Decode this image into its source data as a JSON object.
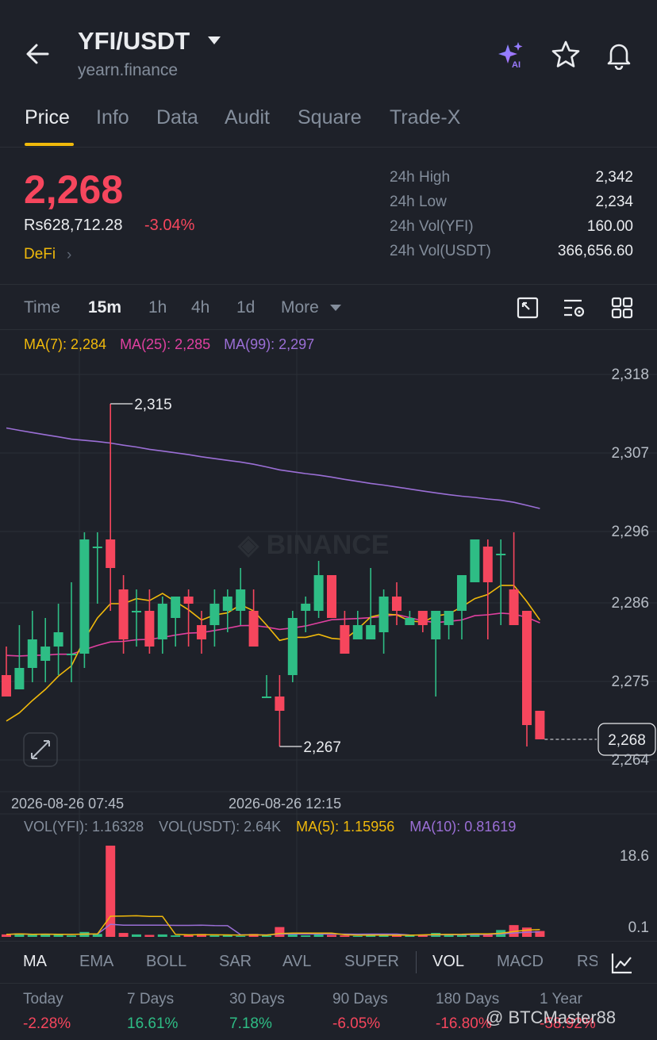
{
  "header": {
    "pair": "YFI/USDT",
    "subtitle": "yearn.finance"
  },
  "tabs": [
    "Price",
    "Info",
    "Data",
    "Audit",
    "Square",
    "Trade-X"
  ],
  "price": {
    "last": "2,268",
    "fiat": "Rs628,712.28",
    "change": "-3.04%",
    "sector": "DeFi"
  },
  "stats": [
    {
      "label": "24h High",
      "value": "2,342"
    },
    {
      "label": "24h Low",
      "value": "2,234"
    },
    {
      "label": "24h Vol(YFI)",
      "value": "160.00"
    },
    {
      "label": "24h Vol(USDT)",
      "value": "366,656.60"
    }
  ],
  "intervals": [
    "Time",
    "15m",
    "1h",
    "4h",
    "1d",
    "More"
  ],
  "ma_legend": {
    "ma7": "MA(7): 2,284",
    "ma25": "MA(25): 2,285",
    "ma99": "MA(99): 2,297"
  },
  "vol_legend": {
    "vol_yfi": "VOL(YFI): 1.16328",
    "vol_usdt": "VOL(USDT): 2.64K",
    "ma5": "MA(5): 1.15956",
    "ma10": "MA(10): 0.81619"
  },
  "indicators": [
    "MA",
    "EMA",
    "BOLL",
    "SAR",
    "AVL",
    "SUPER",
    "VOL",
    "MACD",
    "RS"
  ],
  "performance": [
    {
      "label": "Today",
      "value": "-2.28%"
    },
    {
      "label": "7 Days",
      "value": "16.61%"
    },
    {
      "label": "30 Days",
      "value": "7.18%"
    },
    {
      "label": "90 Days",
      "value": "-6.05%"
    },
    {
      "label": "180 Days",
      "value": "-16.80%"
    },
    {
      "label": "1 Year",
      "value": "-58.92%"
    }
  ],
  "watermark": "@ BTCMaster88",
  "colors": {
    "up": "#2ebd85",
    "down": "#f6465d",
    "accent": "#f0b90b",
    "ma7": "#f0b90b",
    "ma25": "#e040a0",
    "ma99": "#9b6fd6",
    "background": "#1e2129"
  },
  "chart_data": {
    "type": "candlestick",
    "y_axis_labels": [
      "2,318",
      "2,307",
      "2,296",
      "2,286",
      "2,275",
      "2,264"
    ],
    "ylim": [
      2262,
      2322
    ],
    "x_axis_labels": [
      "2026-08-26 07:45",
      "2026-08-26 12:15"
    ],
    "current_price_label": "2,268",
    "high_marker": "2,315",
    "low_marker": "2,267",
    "candles": [
      {
        "o": 2277,
        "h": 2281,
        "l": 2274,
        "c": 2274
      },
      {
        "o": 2275,
        "h": 2284,
        "l": 2275,
        "c": 2278
      },
      {
        "o": 2278,
        "h": 2286,
        "l": 2276,
        "c": 2282
      },
      {
        "o": 2279,
        "h": 2285,
        "l": 2276,
        "c": 2281
      },
      {
        "o": 2281,
        "h": 2287,
        "l": 2277,
        "c": 2283
      },
      {
        "o": 2280,
        "h": 2290,
        "l": 2276,
        "c": 2280
      },
      {
        "o": 2280,
        "h": 2297,
        "l": 2278,
        "c": 2296
      },
      {
        "o": 2295,
        "h": 2297,
        "l": 2287,
        "c": 2295
      },
      {
        "o": 2296,
        "h": 2315,
        "l": 2286,
        "c": 2292
      },
      {
        "o": 2289,
        "h": 2291,
        "l": 2280,
        "c": 2282
      },
      {
        "o": 2286,
        "h": 2289,
        "l": 2281,
        "c": 2286
      },
      {
        "o": 2286,
        "h": 2289,
        "l": 2280,
        "c": 2281
      },
      {
        "o": 2282,
        "h": 2288,
        "l": 2280,
        "c": 2287
      },
      {
        "o": 2285,
        "h": 2288,
        "l": 2281,
        "c": 2288
      },
      {
        "o": 2288,
        "h": 2289,
        "l": 2281,
        "c": 2287
      },
      {
        "o": 2284,
        "h": 2286,
        "l": 2280,
        "c": 2282
      },
      {
        "o": 2284,
        "h": 2289,
        "l": 2281,
        "c": 2287
      },
      {
        "o": 2286,
        "h": 2289,
        "l": 2283,
        "c": 2288
      },
      {
        "o": 2286,
        "h": 2292,
        "l": 2284,
        "c": 2289
      },
      {
        "o": 2286,
        "h": 2289,
        "l": 2281,
        "c": 2281
      },
      {
        "o": 2274,
        "h": 2277,
        "l": 2274,
        "c": 2274
      },
      {
        "o": 2274,
        "h": 2277,
        "l": 2267,
        "c": 2272
      },
      {
        "o": 2277,
        "h": 2286,
        "l": 2276,
        "c": 2285
      },
      {
        "o": 2286,
        "h": 2288,
        "l": 2283,
        "c": 2287
      },
      {
        "o": 2286,
        "h": 2293,
        "l": 2285,
        "c": 2291
      },
      {
        "o": 2291,
        "h": 2291,
        "l": 2285,
        "c": 2285
      },
      {
        "o": 2284,
        "h": 2286,
        "l": 2280,
        "c": 2280
      },
      {
        "o": 2282,
        "h": 2286,
        "l": 2282,
        "c": 2284
      },
      {
        "o": 2282,
        "h": 2292,
        "l": 2282,
        "c": 2284
      },
      {
        "o": 2283,
        "h": 2289,
        "l": 2280,
        "c": 2288
      },
      {
        "o": 2288,
        "h": 2290,
        "l": 2284,
        "c": 2286
      },
      {
        "o": 2284,
        "h": 2286,
        "l": 2284,
        "c": 2285
      },
      {
        "o": 2286,
        "h": 2286,
        "l": 2283,
        "c": 2284
      },
      {
        "o": 2282,
        "h": 2286,
        "l": 2274,
        "c": 2286
      },
      {
        "o": 2284,
        "h": 2286,
        "l": 2282,
        "c": 2286
      },
      {
        "o": 2286,
        "h": 2291,
        "l": 2282,
        "c": 2291
      },
      {
        "o": 2290,
        "h": 2296,
        "l": 2290,
        "c": 2296
      },
      {
        "o": 2295,
        "h": 2296,
        "l": 2282,
        "c": 2290
      },
      {
        "o": 2294,
        "h": 2296,
        "l": 2284,
        "c": 2294
      },
      {
        "o": 2289,
        "h": 2297,
        "l": 2284,
        "c": 2284
      },
      {
        "o": 2286,
        "h": 2286,
        "l": 2267,
        "c": 2270
      },
      {
        "o": 2272,
        "h": 2272,
        "l": 2268,
        "c": 2268
      }
    ],
    "volume_axis_labels": [
      "18.6",
      "0.1"
    ],
    "volume": [
      0.5,
      0.7,
      0.4,
      0.6,
      0.5,
      0.3,
      1.0,
      0.6,
      18.6,
      0.8,
      0.5,
      0.4,
      0.5,
      0.3,
      0.4,
      0.6,
      0.3,
      0.4,
      0.2,
      0.6,
      0.3,
      2.0,
      0.7,
      0.3,
      0.5,
      0.4,
      0.3,
      0.2,
      0.4,
      0.5,
      0.3,
      0.3,
      0.5,
      0.8,
      0.6,
      0.4,
      0.7,
      0.5,
      1.4,
      2.4,
      1.9,
      1.2
    ]
  }
}
